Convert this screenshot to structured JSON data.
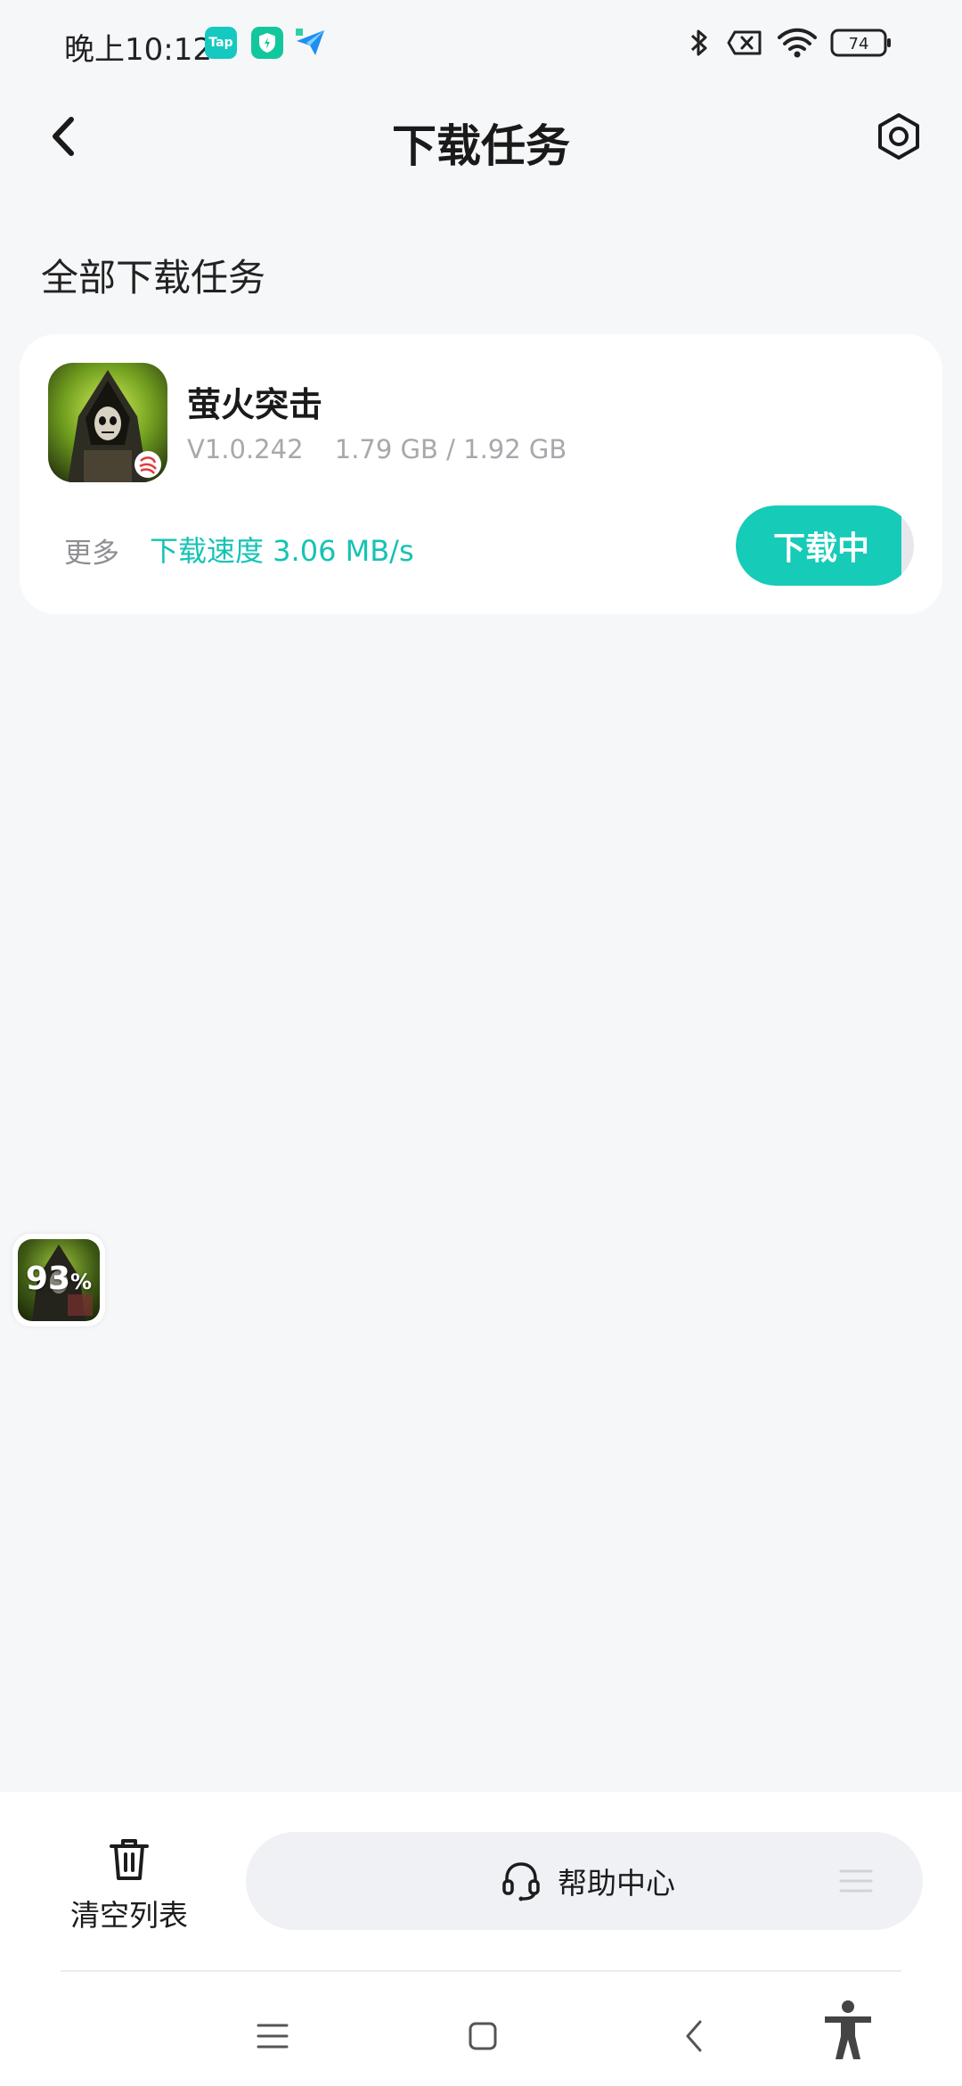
{
  "status_bar": {
    "time": "晚上10:12",
    "tap_label": "Tap",
    "battery": "74"
  },
  "header": {
    "title": "下载任务"
  },
  "section_title": "全部下载任务",
  "task": {
    "name": "萤火突击",
    "version": "V1.0.242",
    "size": "1.79 GB / 1.92 GB",
    "more_label": "更多",
    "speed": "下载速度 3.06 MB/s",
    "button_label": "下载中",
    "progress": 0.93
  },
  "float_bubble": {
    "percent": "93",
    "percent_sign": "%"
  },
  "bottom_bar": {
    "clear_label": "清空列表",
    "help_label": "帮助中心"
  },
  "colors": {
    "accent": "#16cbb8",
    "background": "#f6f7f9"
  }
}
